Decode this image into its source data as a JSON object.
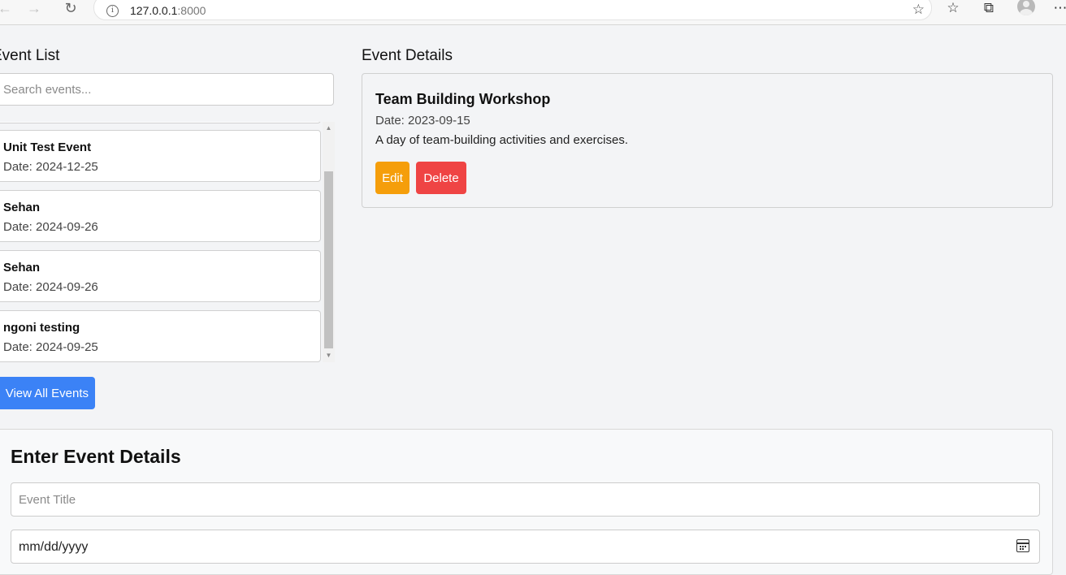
{
  "browser": {
    "url_host": "127.0.0.1",
    "url_port": ":8000"
  },
  "event_list": {
    "heading": "Event List",
    "search_placeholder": "Search events...",
    "events": [
      {
        "title": "Unit Test Event",
        "date": "Date: 2024-12-25"
      },
      {
        "title": "Sehan",
        "date": "Date: 2024-09-26"
      },
      {
        "title": "Sehan",
        "date": "Date: 2024-09-26"
      },
      {
        "title": "ngoni testing",
        "date": "Date: 2024-09-25"
      }
    ],
    "view_all_label": "View All Events"
  },
  "event_details": {
    "heading": "Event Details",
    "title": "Team Building Workshop",
    "date": "Date: 2023-09-15",
    "description": "A day of team-building activities and exercises.",
    "edit_label": "Edit",
    "delete_label": "Delete"
  },
  "form": {
    "heading": "Enter Event Details",
    "title_placeholder": "Event Title",
    "date_placeholder": "mm/dd/yyyy"
  },
  "colors": {
    "primary": "#3b82f6",
    "edit": "#f59e0b",
    "delete": "#ef4444"
  }
}
